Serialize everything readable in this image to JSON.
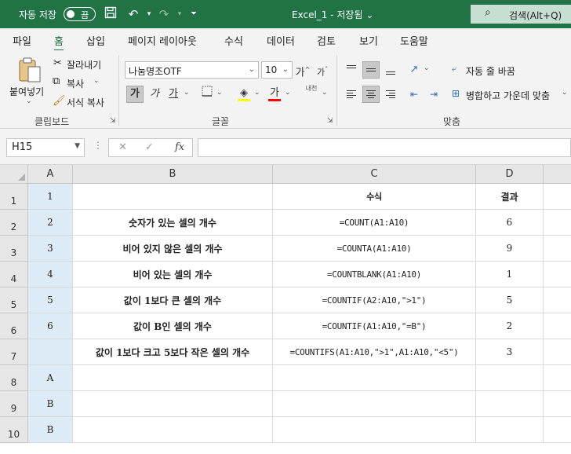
{
  "titlebar": {
    "autosave_label": "자동 저장",
    "autosave_state": "끔",
    "doc_title": "Excel_1  -  저장됨 ⌄",
    "search_placeholder": "검색(Alt+Q)",
    "color": "#217346"
  },
  "tabs": [
    {
      "label": "파일",
      "active": false
    },
    {
      "label": "홈",
      "active": true
    },
    {
      "label": "삽입",
      "active": false
    },
    {
      "label": "페이지 레이아웃",
      "active": false
    },
    {
      "label": "수식",
      "active": false
    },
    {
      "label": "데이터",
      "active": false
    },
    {
      "label": "검토",
      "active": false
    },
    {
      "label": "보기",
      "active": false
    },
    {
      "label": "도움말",
      "active": false
    }
  ],
  "ribbon": {
    "clipboard": {
      "paste_label": "붙여넣기",
      "cut_label": "잘라내기",
      "copy_label": "복사",
      "format_painter_label": "서식 복사",
      "group_label": "클립보드"
    },
    "font": {
      "font_name": "나눔명조OTF",
      "font_size": "10",
      "bold_glyph": "가",
      "italic_glyph": "가",
      "underline_glyph": "가",
      "font_color_glyph": "가",
      "grow_glyph": "가",
      "shrink_glyph": "가",
      "phonetic_glyph": "내천",
      "group_label": "글꼴"
    },
    "alignment": {
      "wrap_text_label": "자동 줄 바꿈",
      "merge_label": "병합하고 가운데 맞춤",
      "group_label": "맞춤"
    }
  },
  "formula_bar": {
    "name_box": "H15",
    "cancel_glyph": "✕",
    "enter_glyph": "✓",
    "fx_glyph": "fx",
    "formula": ""
  },
  "sheet": {
    "columns": [
      "A",
      "B",
      "C",
      "D"
    ],
    "rows": [
      {
        "num": "1",
        "a": "1",
        "b": "",
        "c": "수식",
        "d": "결과"
      },
      {
        "num": "2",
        "a": "2",
        "b": "숫자가 있는 셀의 개수",
        "c": "=COUNT(A1:A10)",
        "d": "6"
      },
      {
        "num": "3",
        "a": "3",
        "b": "비어 있지 않은 셀의 개수",
        "c": "=COUNTA(A1:A10)",
        "d": "9"
      },
      {
        "num": "4",
        "a": "4",
        "b": "비어 있는 셀의 개수",
        "c": "=COUNTBLANK(A1:A10)",
        "d": "1"
      },
      {
        "num": "5",
        "a": "5",
        "b": "값이 1보다 큰 셀의 개수",
        "c": "=COUNTIF(A2:A10,\">1\")",
        "d": "5"
      },
      {
        "num": "6",
        "a": "6",
        "b": "값이 B인 셀의 개수",
        "c": "=COUNTIF(A1:A10,\"=B\")",
        "d": "2"
      },
      {
        "num": "7",
        "a": "",
        "b": "값이 1보다 크고 5보다 작은 셀의 개수",
        "c": "=COUNTIFS(A1:A10,\">1\",A1:A10,\"<5\")",
        "d": "3"
      },
      {
        "num": "8",
        "a": "A",
        "b": "",
        "c": "",
        "d": ""
      },
      {
        "num": "9",
        "a": "B",
        "b": "",
        "c": "",
        "d": ""
      },
      {
        "num": "10",
        "a": "B",
        "b": "",
        "c": "",
        "d": ""
      }
    ],
    "highlight_color": "#ddebf7"
  }
}
